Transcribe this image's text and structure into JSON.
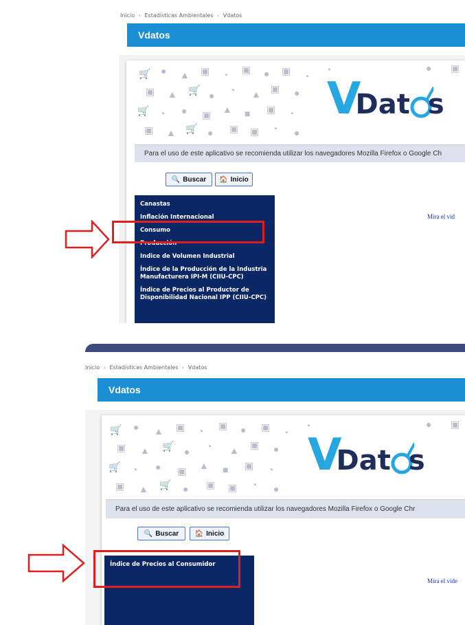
{
  "top": {
    "breadcrumb": [
      "Inicio",
      "Estadísticas Ambientales",
      "Vdatos"
    ],
    "page_title": "Vdatos",
    "logo": {
      "v": "V",
      "text": "Dat",
      "end": "s"
    },
    "notice": "Para el uso de este aplicativo se recomienda utilizar los navegadores Mozilla Firefox o Google Ch",
    "buttons": {
      "search": "Buscar",
      "home": "Inicio"
    },
    "menu_items": [
      "Canastas",
      "Inflación Internacional",
      "Consumo",
      "Producción",
      "Indice de Volumen Industrial",
      "Índice de la Producción de la Industria Manufacturera IPI-M (CIIU-CPC)",
      "Índice de Precios al Productor de Disponibilidad Nacional IPP (CIIU-CPC)"
    ],
    "video_link": "Mira el vid"
  },
  "bottom": {
    "breadcrumb": [
      "Inicio",
      "Estadísticas Ambientales",
      "Vdatos"
    ],
    "page_title": "Vdatos",
    "logo": {
      "v": "V",
      "text": "Dat",
      "end": "s"
    },
    "notice": "Para el uso de este aplicativo se recomienda utilizar los navegadores Mozilla Firefox o Google Chr",
    "buttons": {
      "search": "Buscar",
      "home": "Inicio"
    },
    "menu_items": [
      "Índice de Precios al Consumidor"
    ],
    "video_link": "Mira el vide"
  },
  "colors": {
    "title_bar": "#1a8fd3",
    "menu_bg": "#0b2766",
    "highlight": "#e01e1e",
    "logo_v": "#27a7e2",
    "logo_text": "#1f2d5a"
  },
  "icons": {
    "search": "search-icon",
    "home": "home-icon",
    "arrow": "right-arrow-icon"
  }
}
